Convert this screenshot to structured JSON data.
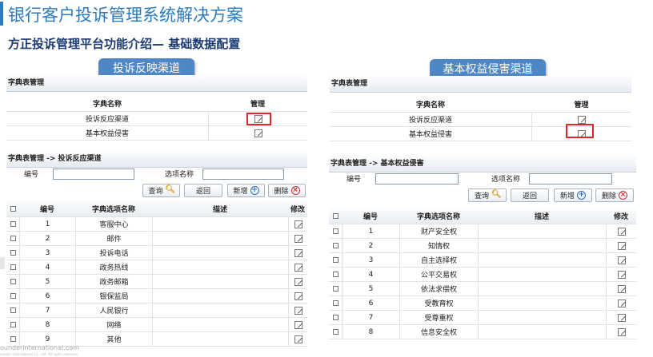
{
  "title": "银行客户投诉管理系统解决方案",
  "subtitle": "方正投诉管理平台功能介绍— 基础数据配置",
  "left_tag": "投诉反映渠道",
  "right_tag": "基本权益侵害渠道",
  "dict_panel": {
    "title": "字典表管理",
    "col_name": "字典名称",
    "col_manage": "管理",
    "rows": [
      "投诉反应渠道",
      "基本权益侵害"
    ]
  },
  "left_detail": {
    "title": "字典表管理 -> 投诉反应渠道",
    "rows": [
      "客服中心",
      "邮件",
      "投诉电话",
      "政务热线",
      "政务邮箱",
      "银保监局",
      "人民银行",
      "网络",
      "其他"
    ]
  },
  "right_detail": {
    "title": "字典表管理 -> 基本权益侵害",
    "rows": [
      "财产安全权",
      "知情权",
      "自主选择权",
      "公平交易权",
      "依法求偿权",
      "受教育权",
      "受尊重权",
      "信息安全权"
    ]
  },
  "form": {
    "label_no": "编号",
    "label_option": "选项名称",
    "btn_query": "查询",
    "btn_back": "返回",
    "btn_add": "新增",
    "btn_delete": "删除"
  },
  "table_head": {
    "no": "编号",
    "option": "字典选项名称",
    "desc": "描述",
    "edit": "修改"
  },
  "numbers": [
    "1",
    "2",
    "3",
    "4",
    "5",
    "6",
    "7",
    "8",
    "9"
  ],
  "footer": {
    "line1": "ounderinternational.com",
    "line2": "ounder International Co., Ltd. All rights reserved."
  },
  "colors": {
    "accent": "#2a7bc0",
    "tag": "#4f86c6",
    "highlight": "#e0262b"
  }
}
